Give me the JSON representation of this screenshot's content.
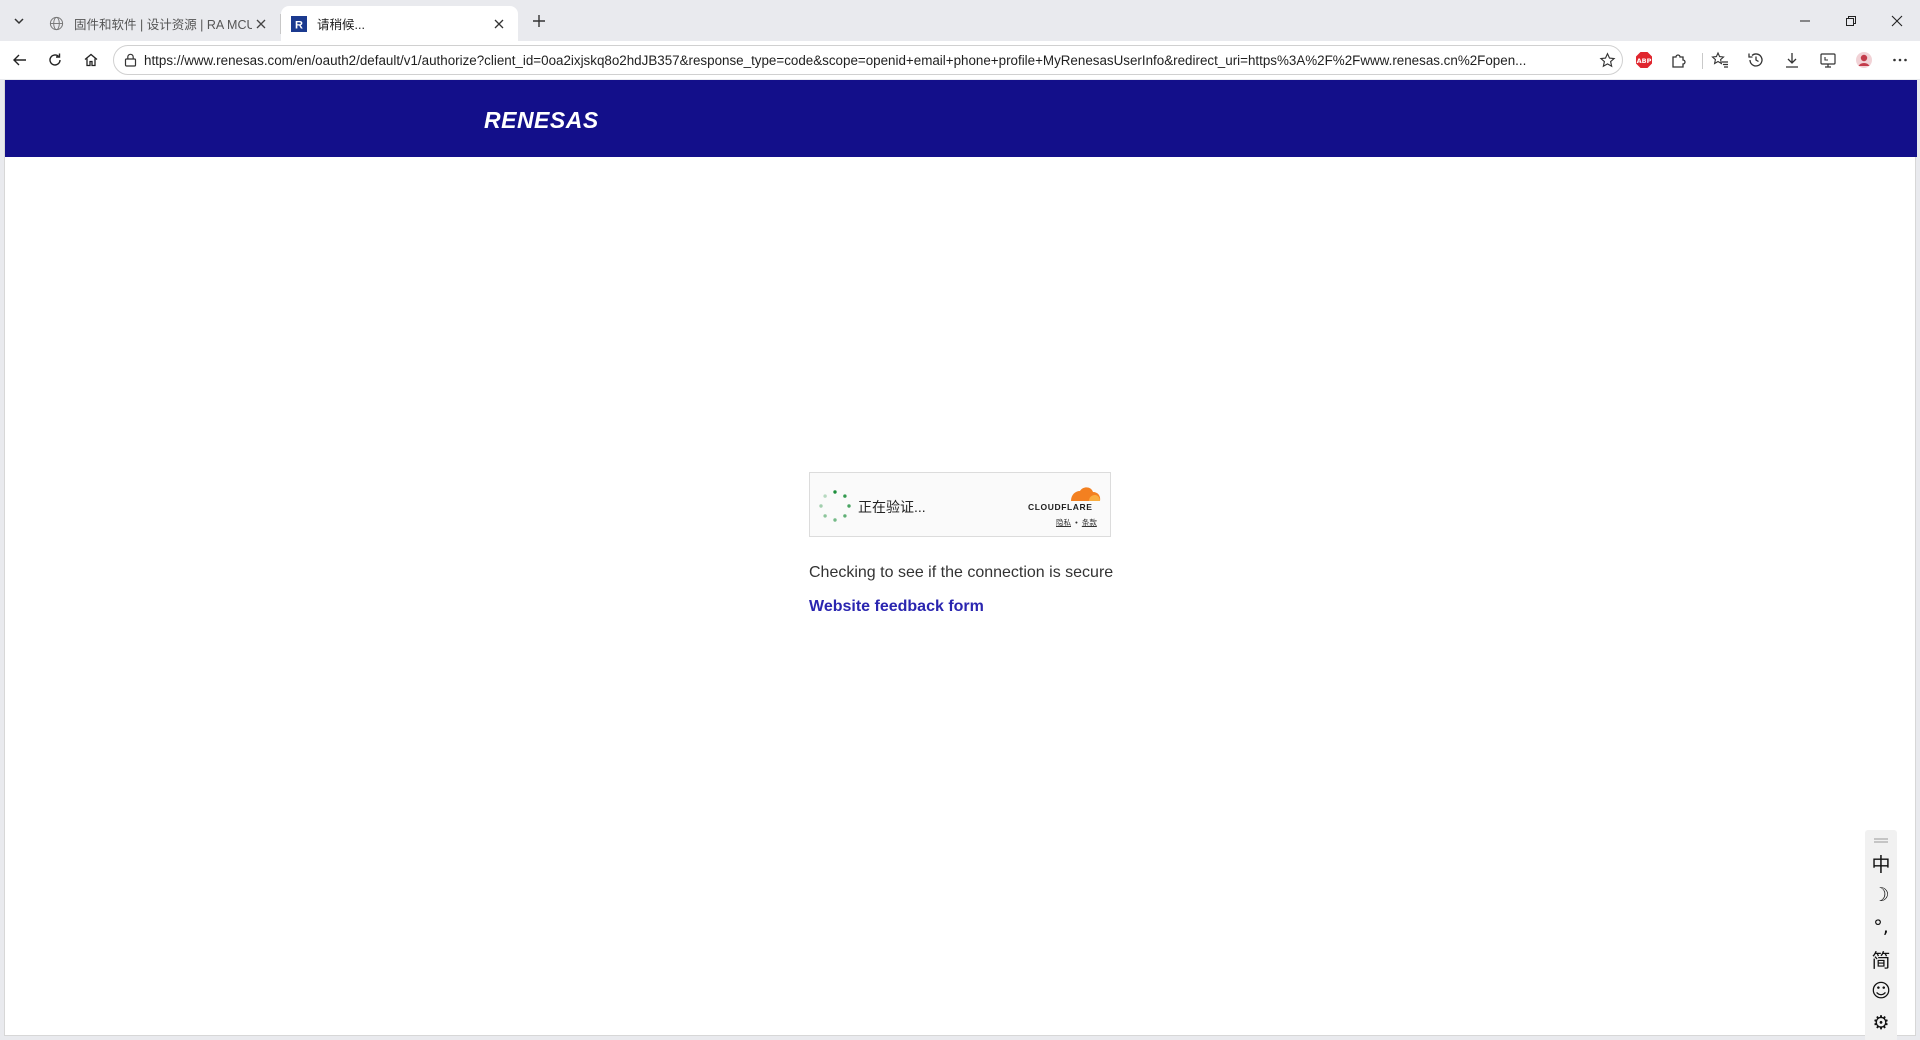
{
  "browser": {
    "tabs": [
      {
        "title": "固件和软件 | 设计资源 | RA MCU |",
        "active": false
      },
      {
        "title": "请稍候...",
        "active": true
      }
    ],
    "address_url": "https://www.renesas.com/en/oauth2/default/v1/authorize?client_id=0oa2ixjskq8o2hdJB357&response_type=code&scope=openid+email+phone+profile+MyRenesasUserInfo&redirect_uri=https%3A%2F%2Fwww.renesas.cn%2Fopen..."
  },
  "page": {
    "logo_text": "RENESAS",
    "challenge": {
      "status_text": "正在验证...",
      "brand": "CLOUDFLARE",
      "privacy_link": "隐私",
      "separator": "•",
      "terms_link": "条款"
    },
    "message": "Checking to see if the connection is secure",
    "feedback_link": "Website feedback form"
  },
  "ime_toolbar": {
    "items": [
      "中",
      "☽",
      "°,",
      "简",
      "☺",
      "⚙"
    ]
  },
  "colors": {
    "header_bg": "#130f8a",
    "link": "#2a25b0",
    "cloudflare_orange": "#f38020",
    "spinner_green": "#1d8f3c"
  }
}
